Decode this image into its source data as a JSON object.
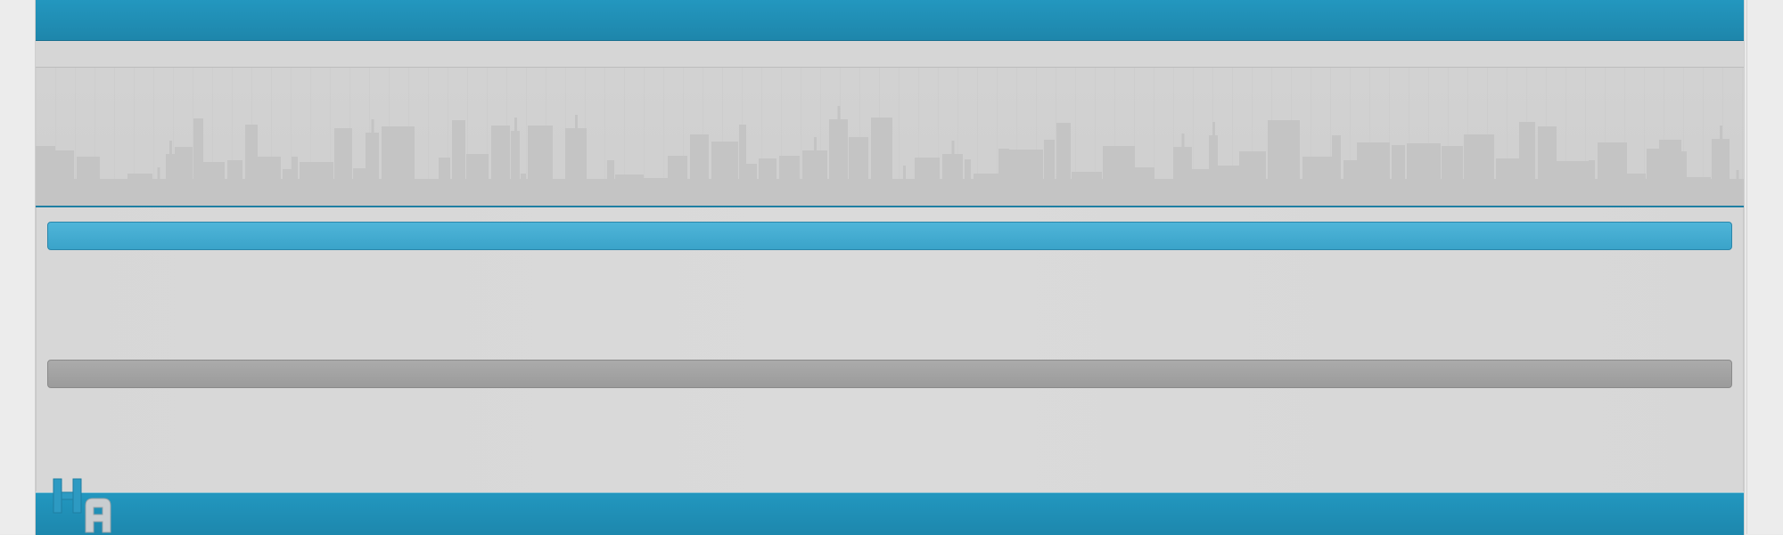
{
  "window": {
    "title": ""
  },
  "header": {
    "title": ""
  },
  "subnav": {
    "items": []
  },
  "content": {
    "blocks": [
      {
        "title": "",
        "style": "blue"
      },
      {
        "title": "",
        "style": "gray"
      }
    ]
  },
  "footer": {
    "logo": {
      "letters": [
        "H",
        "A"
      ]
    }
  },
  "colors": {
    "brand_blue": "#2397bf",
    "bar_blue": "#46adcf",
    "bar_gray": "#a3a3a3",
    "background": "#d8d8d8",
    "skyline": "#c4c4c4"
  }
}
